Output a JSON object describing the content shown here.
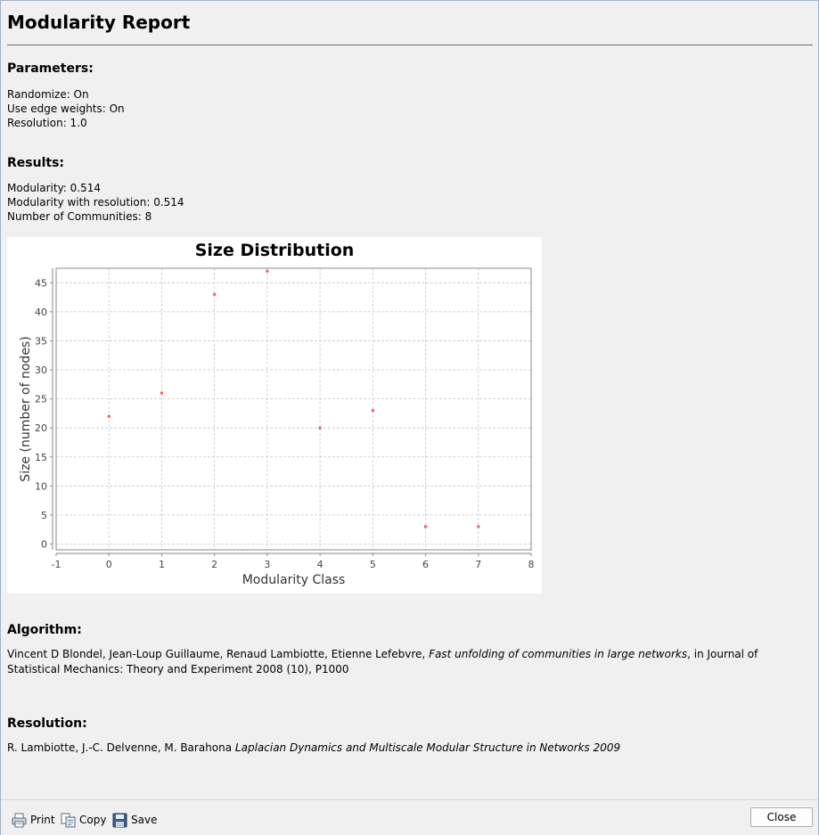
{
  "report": {
    "title": "Modularity Report",
    "parameters_heading": "Parameters:",
    "parameters": [
      "Randomize: On",
      "Use edge weights: On",
      "Resolution: 1.0"
    ],
    "results_heading": "Results:",
    "results": [
      "Modularity: 0.514",
      "Modularity with resolution: 0.514",
      "Number of Communities: 8"
    ],
    "algorithm_heading": "Algorithm:",
    "algorithm": {
      "authors": "Vincent D Blondel, Jean-Loup Guillaume, Renaud Lambiotte, Etienne Lefebvre, ",
      "paper": "Fast unfolding of communities in large networks",
      "source": ", in Journal of Statistical Mechanics: Theory and Experiment 2008 (10), P1000"
    },
    "resolution_heading": "Resolution:",
    "resolution": {
      "authors": "R. Lambiotte, J.-C. Delvenne, M. Barahona ",
      "paper": "Laplacian Dynamics and Multiscale Modular Structure in Networks 2009"
    }
  },
  "chart_data": {
    "type": "scatter",
    "title": "Size Distribution",
    "xlabel": "Modularity Class",
    "ylabel": "Size (number of nodes)",
    "xlim": [
      -1,
      8
    ],
    "ylim": [
      -1,
      47.5
    ],
    "xticks": [
      -1,
      0,
      1,
      2,
      3,
      4,
      5,
      6,
      7,
      8
    ],
    "yticks": [
      0,
      5,
      10,
      15,
      20,
      25,
      30,
      35,
      40,
      45
    ],
    "grid": true,
    "point_color": "#ff5555",
    "points": [
      {
        "x": 0,
        "y": 22
      },
      {
        "x": 1,
        "y": 26
      },
      {
        "x": 2,
        "y": 43
      },
      {
        "x": 3,
        "y": 47
      },
      {
        "x": 4,
        "y": 20
      },
      {
        "x": 5,
        "y": 23
      },
      {
        "x": 6,
        "y": 3
      },
      {
        "x": 7,
        "y": 3
      }
    ]
  },
  "footer": {
    "print_label": "Print",
    "copy_label": "Copy",
    "save_label": "Save",
    "close_label": "Close"
  }
}
